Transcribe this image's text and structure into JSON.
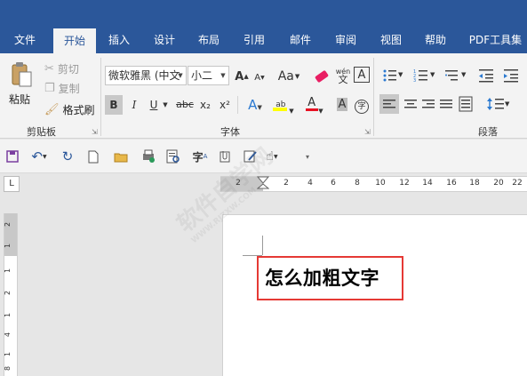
{
  "tabs": [
    "文件",
    "开始",
    "插入",
    "设计",
    "布局",
    "引用",
    "邮件",
    "审阅",
    "视图",
    "帮助",
    "PDF工具集"
  ],
  "active_tab": "开始",
  "clipboard": {
    "paste": "粘贴",
    "cut": "剪切",
    "copy": "复制",
    "format_painter": "格式刷",
    "group": "剪贴板"
  },
  "font": {
    "family": "微软雅黑 (中文",
    "size": "小二",
    "aa": "Aa",
    "wen": "wén",
    "A_box": "A",
    "bold": "B",
    "italic": "I",
    "underline": "U",
    "strike": "abc",
    "sub": "x₂",
    "sup": "x²",
    "char_circle": "字",
    "group": "字体"
  },
  "paragraph": {
    "group": "段落"
  },
  "ruler": {
    "h": [
      "2",
      "2",
      "4",
      "6",
      "8",
      "10",
      "12",
      "14",
      "16",
      "18",
      "20",
      "22"
    ],
    "v": [
      "2",
      "1",
      "1",
      "2",
      "1",
      "4",
      "1",
      "6",
      "1",
      "8"
    ],
    "corner": "L"
  },
  "document": {
    "text": "怎么加粗文字"
  },
  "watermark": "软件自学网",
  "watermark_url": "WWW.RJZXW.COM",
  "colors": {
    "brand": "#2b579a",
    "highlight_box": "#e53935",
    "font_color": "#e81123",
    "highlight_yellow": "#ffff00"
  }
}
